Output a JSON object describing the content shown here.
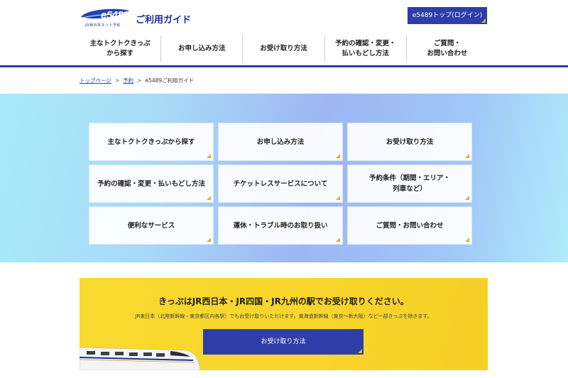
{
  "header": {
    "logo_text": "e5489",
    "logo_sub": "JR西日本ネット予約",
    "guide_title": "ご利用ガイド",
    "top_button": "e5489トップ(ログイン)"
  },
  "nav": {
    "items": [
      {
        "line1": "主なトクトクきっぷ",
        "line2": "から探す"
      },
      {
        "line1": "お申し込み方法",
        "line2": ""
      },
      {
        "line1": "お受け取り方法",
        "line2": ""
      },
      {
        "line1": "予約の確認・変更・",
        "line2": "払いもどし方法"
      },
      {
        "line1": "ご質問・",
        "line2": "お問い合わせ"
      }
    ]
  },
  "breadcrumb": {
    "home": "トップページ",
    "reserve": "予約",
    "current": "e5489ご利用ガイド",
    "separator": ">"
  },
  "menu": {
    "cards": [
      {
        "line1": "主なトクトクきっぷから探す",
        "line2": ""
      },
      {
        "line1": "お申し込み方法",
        "line2": ""
      },
      {
        "line1": "お受け取り方法",
        "line2": ""
      },
      {
        "line1": "予約の確認・変更・払いもどし方法",
        "line2": ""
      },
      {
        "line1": "チケットレスサービスについて",
        "line2": ""
      },
      {
        "line1": "予約条件（期間・エリア・",
        "line2": "列車など）"
      },
      {
        "line1": "便利なサービス",
        "line2": ""
      },
      {
        "line1": "運休・トラブル時のお取り扱い",
        "line2": ""
      },
      {
        "line1": "ご質問・お問い合わせ",
        "line2": ""
      }
    ]
  },
  "banner": {
    "title": "きっぷはJR西日本・JR四国・JR九州の駅でお受け取りください。",
    "note": "JR東日本（北陸新幹線・東京都区内各駅）でもお受け取りいただけます。東海道新幹線（東京～新大阪）など一部きっぷを除きます。",
    "button": "お受け取り方法"
  },
  "colors": {
    "brand_blue": "#2d3ea8",
    "accent_gold": "#d6b33a",
    "banner_yellow": "#f9da2e"
  }
}
